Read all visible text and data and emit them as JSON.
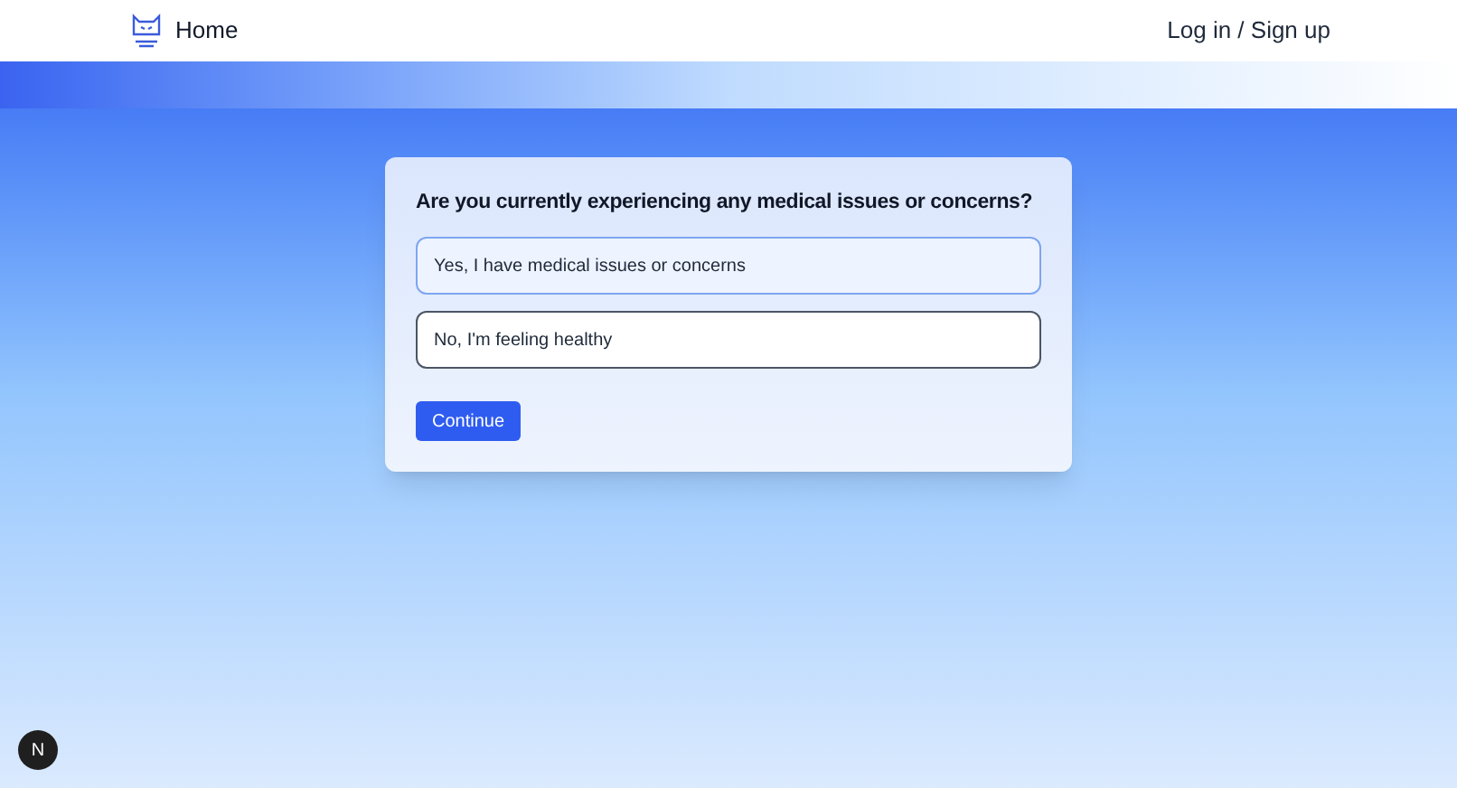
{
  "nav": {
    "home": "Home",
    "auth": "Log in / Sign up"
  },
  "question": {
    "title": "Are you currently experiencing any medical issues or concerns?",
    "options": [
      {
        "label": "Yes, I have medical issues or concerns",
        "selected": true
      },
      {
        "label": "No, I'm feeling healthy",
        "selected": false
      }
    ],
    "button": "Continue"
  },
  "dev_badge": "N"
}
